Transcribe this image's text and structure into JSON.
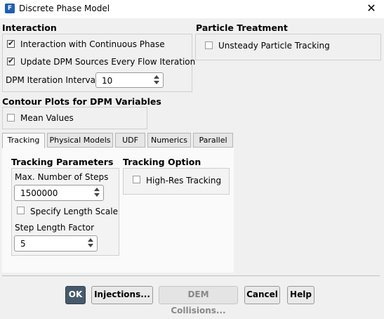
{
  "window": {
    "title": "Discrete Phase Model",
    "icon_name": "fluent-app-icon",
    "close_glyph": "✕"
  },
  "interaction": {
    "heading": "Interaction",
    "continuous_phase": {
      "label": "Interaction with Continuous Phase",
      "checked": true
    },
    "update_sources": {
      "label": "Update DPM Sources Every Flow Iteration",
      "checked": true
    },
    "iteration_interval": {
      "label": "DPM Iteration Interval",
      "value": "10"
    }
  },
  "particle_treatment": {
    "heading": "Particle Treatment",
    "unsteady": {
      "label": "Unsteady Particle Tracking",
      "checked": false
    }
  },
  "contour": {
    "heading": "Contour Plots for DPM Variables",
    "mean_values": {
      "label": "Mean Values",
      "checked": false
    }
  },
  "tabs": [
    {
      "label": "Tracking",
      "active": true
    },
    {
      "label": "Physical Models",
      "active": false
    },
    {
      "label": "UDF",
      "active": false
    },
    {
      "label": "Numerics",
      "active": false
    },
    {
      "label": "Parallel",
      "active": false
    }
  ],
  "tracking": {
    "parameters_heading": "Tracking Parameters",
    "max_steps": {
      "label": "Max. Number of Steps",
      "value": "1500000"
    },
    "specify_length": {
      "label": "Specify Length Scale",
      "checked": false
    },
    "step_length": {
      "label": "Step Length Factor",
      "value": "5"
    },
    "option_heading": "Tracking Option",
    "high_res": {
      "label": "High-Res Tracking",
      "checked": false
    }
  },
  "buttons": {
    "ok": "OK",
    "injections": "Injections...",
    "dem": "DEM Collisions...",
    "cancel": "Cancel",
    "help": "Help"
  },
  "colors": {
    "primary_button": "#475a6b",
    "app_icon": "#1e5fb4"
  }
}
